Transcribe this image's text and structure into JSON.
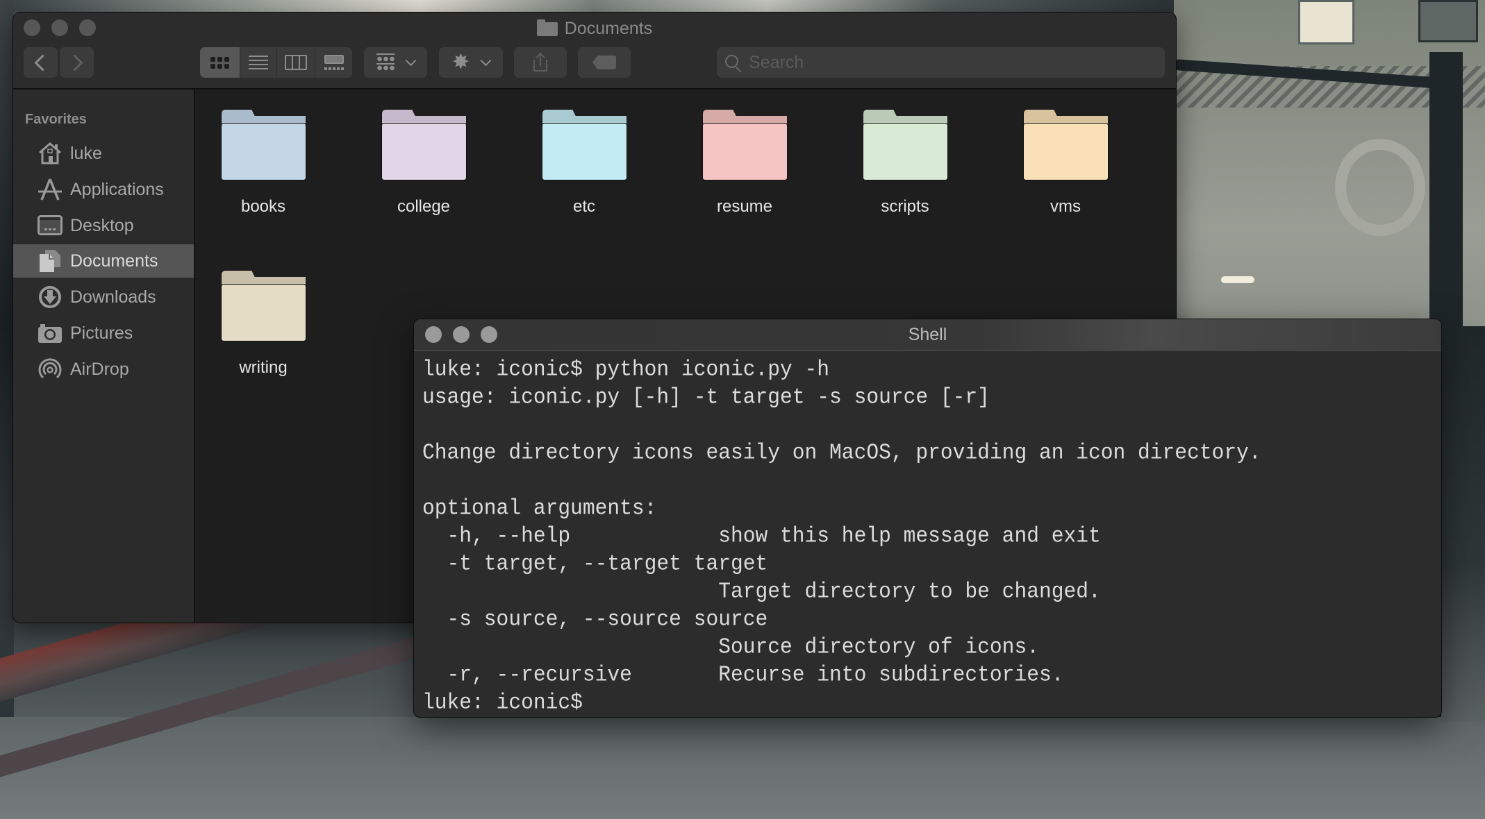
{
  "finder": {
    "title": "Documents",
    "toolbar": {
      "back_icon": "chevron-left-icon",
      "forward_icon": "chevron-right-icon",
      "view_modes": [
        {
          "name": "icon-view",
          "icon": "grid-icon",
          "selected": true
        },
        {
          "name": "list-view",
          "icon": "list-icon",
          "selected": false
        },
        {
          "name": "column-view",
          "icon": "columns-icon",
          "selected": false
        },
        {
          "name": "gallery-view",
          "icon": "gallery-icon",
          "selected": false
        }
      ],
      "group_icon": "group-by-icon",
      "action_icon": "gear",
      "gear_glyph": "✸",
      "share_icon": "share-icon",
      "tag_icon": "tag-icon",
      "search_placeholder": "Search",
      "search_value": ""
    },
    "sidebar": {
      "section_title": "Favorites",
      "items": [
        {
          "label": "luke",
          "icon": "home-icon",
          "selected": false
        },
        {
          "label": "Applications",
          "icon": "applications-icon",
          "selected": false
        },
        {
          "label": "Desktop",
          "icon": "desktop-icon",
          "selected": false
        },
        {
          "label": "Documents",
          "icon": "documents-icon",
          "selected": true
        },
        {
          "label": "Downloads",
          "icon": "downloads-icon",
          "selected": false
        },
        {
          "label": "Pictures",
          "icon": "camera-icon",
          "selected": false
        },
        {
          "label": "AirDrop",
          "icon": "airdrop-icon",
          "selected": false
        }
      ]
    },
    "folders": [
      {
        "name": "books",
        "color": "#c3d7e6",
        "tab_color": "#aabccb"
      },
      {
        "name": "college",
        "color": "#e2d5e7",
        "tab_color": "#c6b9cb"
      },
      {
        "name": "etc",
        "color": "#c3ebf2",
        "tab_color": "#aacbd1"
      },
      {
        "name": "resume",
        "color": "#f4c5c2",
        "tab_color": "#d5aaa7"
      },
      {
        "name": "scripts",
        "color": "#d9ebd4",
        "tab_color": "#bccbb8"
      },
      {
        "name": "vms",
        "color": "#f9e0b8",
        "tab_color": "#d9c39f"
      },
      {
        "name": "writing",
        "color": "#e5dcc6",
        "tab_color": "#c8bfab"
      }
    ]
  },
  "shell": {
    "title": "Shell",
    "lines": [
      "luke: iconic$ python iconic.py -h",
      "usage: iconic.py [-h] -t target -s source [-r]",
      "",
      "Change directory icons easily on MacOS, providing an icon directory.",
      "",
      "optional arguments:",
      "  -h, --help            show this help message and exit",
      "  -t target, --target target",
      "                        Target directory to be changed.",
      "  -s source, --source source",
      "                        Source directory of icons.",
      "  -r, --recursive       Recurse into subdirectories.",
      "luke: iconic$"
    ]
  }
}
